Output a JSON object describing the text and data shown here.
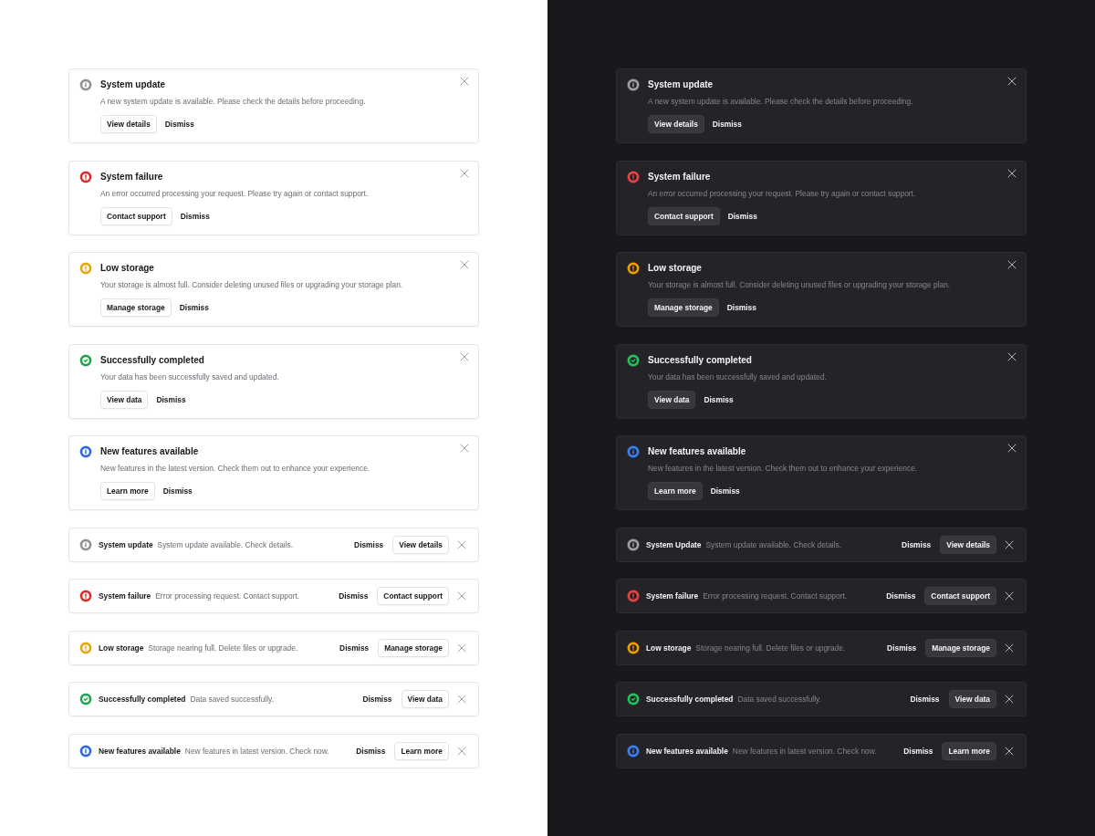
{
  "panels": [
    {
      "kind": "light",
      "alerts": [
        {
          "kind": "neutral",
          "color": "#8e8e96",
          "title": "System update",
          "message": "A new system update is available. Please check the details before proceeding.",
          "action": "View details",
          "dismiss": "Dismiss"
        },
        {
          "kind": "error",
          "color": "#dc2626",
          "title": "System failure",
          "message": "An error occurred processing your request. Please try again or contact support.",
          "action": "Contact support",
          "dismiss": "Dismiss"
        },
        {
          "kind": "warning",
          "color": "#e5a400",
          "title": "Low storage",
          "message": "Your storage is almost full. Consider deleting unused files or upgrading your storage plan.",
          "action": "Manage storage",
          "dismiss": "Dismiss"
        },
        {
          "kind": "success",
          "color": "#16a34a",
          "title": "Successfully completed",
          "message": "Your data has been successfully saved and updated.",
          "action": "View data",
          "dismiss": "Dismiss"
        },
        {
          "kind": "info",
          "color": "#2563eb",
          "title": "New features available",
          "message": "New features in the latest version. Check them out to enhance your experience.",
          "action": "Learn more",
          "dismiss": "Dismiss"
        }
      ],
      "compact_alerts": [
        {
          "kind": "neutral",
          "color": "#8e8e96",
          "title": "System update",
          "message": "System update available. Check details.",
          "dismiss": "Dismiss",
          "action": "View details"
        },
        {
          "kind": "error",
          "color": "#dc2626",
          "title": "System failure",
          "message": "Error processing request. Contact support.",
          "dismiss": "Dismiss",
          "action": "Contact support"
        },
        {
          "kind": "warning",
          "color": "#e5a400",
          "title": "Low storage",
          "message": "Storage nearing full. Delete files or upgrade.",
          "dismiss": "Dismiss",
          "action": "Manage storage"
        },
        {
          "kind": "success",
          "color": "#16a34a",
          "title": "Successfully completed",
          "message": "Data saved successfully.",
          "dismiss": "Dismiss",
          "action": "View data"
        },
        {
          "kind": "info",
          "color": "#2563eb",
          "title": "New features available",
          "message": "New features in latest version. Check now.",
          "dismiss": "Dismiss",
          "action": "Learn more"
        }
      ]
    },
    {
      "kind": "dark",
      "alerts": [
        {
          "kind": "neutral",
          "color": "#a1a1aa",
          "title": "System update",
          "message": "A new system update is available. Please check the details before proceeding.",
          "action": "View details",
          "dismiss": "Dismiss"
        },
        {
          "kind": "error",
          "color": "#ef4444",
          "title": "System failure",
          "message": "An error occurred processing your request. Please try again or contact support.",
          "action": "Contact support",
          "dismiss": "Dismiss"
        },
        {
          "kind": "warning",
          "color": "#f59e0b",
          "title": "Low storage",
          "message": "Your storage is almost full. Consider deleting unused files or upgrading your storage plan.",
          "action": "Manage storage",
          "dismiss": "Dismiss"
        },
        {
          "kind": "success",
          "color": "#22c55e",
          "title": "Successfully completed",
          "message": "Your data has been successfully saved and updated.",
          "action": "View data",
          "dismiss": "Dismiss"
        },
        {
          "kind": "info",
          "color": "#3b82f6",
          "title": "New features available",
          "message": "New features in the latest version. Check them out to enhance your experience.",
          "action": "Learn more",
          "dismiss": "Dismiss"
        }
      ],
      "compact_alerts": [
        {
          "kind": "neutral",
          "color": "#a1a1aa",
          "title": "System Update",
          "message": "System update available. Check details.",
          "dismiss": "Dismiss",
          "action": "View details"
        },
        {
          "kind": "error",
          "color": "#ef4444",
          "title": "System failure",
          "message": "Error processing request. Contact support.",
          "dismiss": "Dismiss",
          "action": "Contact support"
        },
        {
          "kind": "warning",
          "color": "#f59e0b",
          "title": "Low storage",
          "message": "Storage nearing full. Delete files or upgrade.",
          "dismiss": "Dismiss",
          "action": "Manage storage"
        },
        {
          "kind": "success",
          "color": "#22c55e",
          "title": "Successfully completed",
          "message": "Data saved successfully.",
          "dismiss": "Dismiss",
          "action": "View data"
        },
        {
          "kind": "info",
          "color": "#3b82f6",
          "title": "New features available",
          "message": "New features in latest version. Check now.",
          "dismiss": "Dismiss",
          "action": "Learn more"
        }
      ]
    }
  ]
}
